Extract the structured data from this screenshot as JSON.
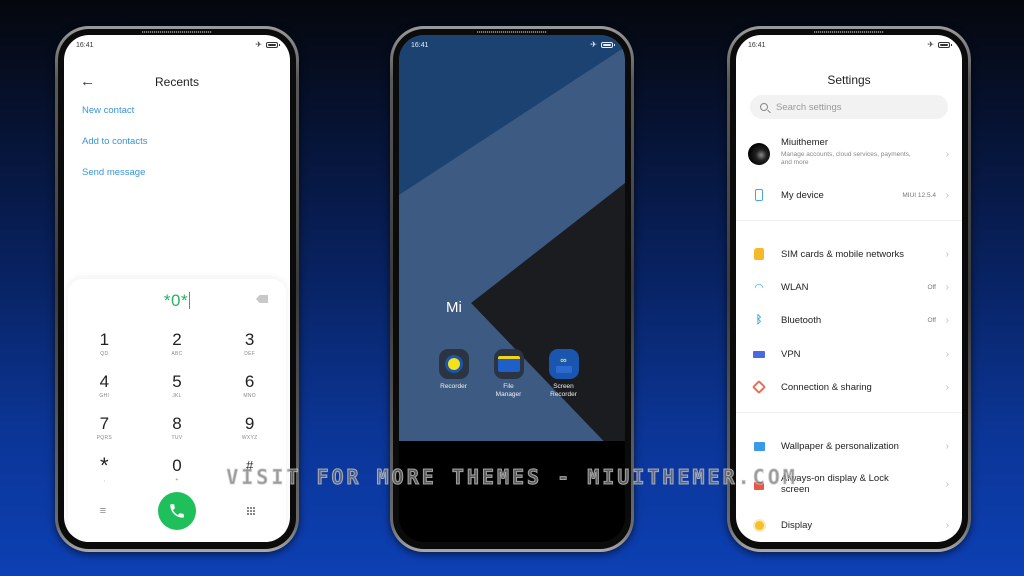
{
  "status_time": "16:41",
  "dialer": {
    "title": "Recents",
    "actions": [
      "New contact",
      "Add to contacts",
      "Send message"
    ],
    "input_value": "*0*",
    "keys": [
      {
        "digit": "1",
        "letters": "QD"
      },
      {
        "digit": "2",
        "letters": "ABC"
      },
      {
        "digit": "3",
        "letters": "DEF"
      },
      {
        "digit": "4",
        "letters": "GHI"
      },
      {
        "digit": "5",
        "letters": "JKL"
      },
      {
        "digit": "6",
        "letters": "MNO"
      },
      {
        "digit": "7",
        "letters": "PQRS"
      },
      {
        "digit": "8",
        "letters": "TUV"
      },
      {
        "digit": "9",
        "letters": "WXYZ"
      },
      {
        "digit": "*",
        "letters": ","
      },
      {
        "digit": "0",
        "letters": "+"
      },
      {
        "digit": "#",
        "letters": ""
      }
    ],
    "accent_color": "#1fbf5c"
  },
  "home": {
    "label": "Mi",
    "apps": [
      {
        "name": "Recorder",
        "icon": "recorder-icon"
      },
      {
        "name": "File Manager",
        "icon": "folder-icon"
      },
      {
        "name": "Screen Recorder",
        "icon": "screen-recorder-icon"
      }
    ]
  },
  "settings": {
    "title": "Settings",
    "search_placeholder": "Search settings",
    "account": {
      "name": "Miuithemer",
      "subtitle": "Manage accounts, cloud services, payments, and more"
    },
    "items": [
      {
        "label": "My device",
        "value": "MIUI 12.5.4",
        "icon": "phone-icon"
      },
      {
        "label": "SIM cards & mobile networks",
        "value": "",
        "icon": "sim-card-icon"
      },
      {
        "label": "WLAN",
        "value": "Off",
        "icon": "wifi-icon"
      },
      {
        "label": "Bluetooth",
        "value": "Off",
        "icon": "bluetooth-icon"
      },
      {
        "label": "VPN",
        "value": "",
        "icon": "vpn-icon"
      },
      {
        "label": "Connection & sharing",
        "value": "",
        "icon": "connection-sharing-icon"
      },
      {
        "label": "Wallpaper & personalization",
        "value": "",
        "icon": "wallpaper-icon"
      },
      {
        "label": "Always-on display & Lock screen",
        "value": "",
        "icon": "lock-icon"
      },
      {
        "label": "Display",
        "value": "",
        "icon": "sun-icon"
      }
    ]
  },
  "watermark": "VISIT FOR MORE THEMES - MIUITHEMER.COM"
}
